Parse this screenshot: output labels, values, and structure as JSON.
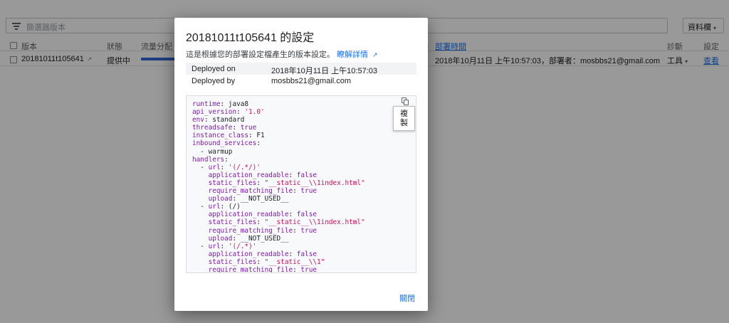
{
  "background": {
    "filter_placeholder": "篩選器版本",
    "columns_button": "資料欄",
    "columns_caret": "▾",
    "headers": {
      "version": "版本",
      "status": "狀態",
      "traffic": "流量分配",
      "deployed_time": "部署時間",
      "sort_arrow": "↓",
      "diagnose": "診斷",
      "config": "設定"
    },
    "row": {
      "version": "20181011t105641",
      "status": "提供中",
      "traffic_fraction": 1.0,
      "deployed": "2018年10月11日 上午10:57:03，部署者：mosbbs21@gmail.com",
      "tools": "工具",
      "tools_caret": "▾",
      "view": "查看"
    }
  },
  "dialog": {
    "title": "20181011t105641 的設定",
    "description": "這是根據您的部署設定檔產生的版本設定。",
    "learn_more": "瞭解詳情",
    "info": [
      {
        "key": "Deployed on",
        "value": "2018年10月11日 上午10:57:03"
      },
      {
        "key": "Deployed by",
        "value": "mosbbs21@gmail.com"
      }
    ],
    "copy_tooltip": [
      "複",
      "製"
    ],
    "close": "關閉",
    "code": [
      [
        [
          "key",
          "runtime"
        ],
        [
          "plain",
          ": java8"
        ]
      ],
      [
        [
          "key",
          "api_version"
        ],
        [
          "plain",
          ": "
        ],
        [
          "str",
          "'1.0'"
        ]
      ],
      [
        [
          "key",
          "env"
        ],
        [
          "plain",
          ": standard"
        ]
      ],
      [
        [
          "key",
          "threadsafe"
        ],
        [
          "plain",
          ": "
        ],
        [
          "bool",
          "true"
        ]
      ],
      [
        [
          "key",
          "instance_class"
        ],
        [
          "plain",
          ": F1"
        ]
      ],
      [
        [
          "key",
          "inbound_services"
        ],
        [
          "plain",
          ":"
        ]
      ],
      [
        [
          "plain",
          "  - warmup"
        ]
      ],
      [
        [
          "key",
          "handlers"
        ],
        [
          "plain",
          ":"
        ]
      ],
      [
        [
          "plain",
          "  - "
        ],
        [
          "key",
          "url"
        ],
        [
          "plain",
          ": "
        ],
        [
          "str",
          "'(/.*/)'"
        ]
      ],
      [
        [
          "plain",
          "    "
        ],
        [
          "key",
          "application_readable"
        ],
        [
          "plain",
          ": "
        ],
        [
          "bool",
          "false"
        ]
      ],
      [
        [
          "plain",
          "    "
        ],
        [
          "key",
          "static_files"
        ],
        [
          "plain",
          ": "
        ],
        [
          "str",
          "\"__static__\\\\1index.html\""
        ]
      ],
      [
        [
          "plain",
          "    "
        ],
        [
          "key",
          "require_matching_file"
        ],
        [
          "plain",
          ": "
        ],
        [
          "bool",
          "true"
        ]
      ],
      [
        [
          "plain",
          "    "
        ],
        [
          "key",
          "upload"
        ],
        [
          "plain",
          ": __NOT_USED__"
        ]
      ],
      [
        [
          "plain",
          "  - "
        ],
        [
          "key",
          "url"
        ],
        [
          "plain",
          ": (/)"
        ]
      ],
      [
        [
          "plain",
          "    "
        ],
        [
          "key",
          "application_readable"
        ],
        [
          "plain",
          ": "
        ],
        [
          "bool",
          "false"
        ]
      ],
      [
        [
          "plain",
          "    "
        ],
        [
          "key",
          "static_files"
        ],
        [
          "plain",
          ": "
        ],
        [
          "str",
          "\"__static__\\\\1index.html\""
        ]
      ],
      [
        [
          "plain",
          "    "
        ],
        [
          "key",
          "require_matching_file"
        ],
        [
          "plain",
          ": "
        ],
        [
          "bool",
          "true"
        ]
      ],
      [
        [
          "plain",
          "    "
        ],
        [
          "key",
          "upload"
        ],
        [
          "plain",
          ": __NOT_USED__"
        ]
      ],
      [
        [
          "plain",
          "  - "
        ],
        [
          "key",
          "url"
        ],
        [
          "plain",
          ": "
        ],
        [
          "str",
          "'(/.*)'"
        ]
      ],
      [
        [
          "plain",
          "    "
        ],
        [
          "key",
          "application_readable"
        ],
        [
          "plain",
          ": "
        ],
        [
          "bool",
          "false"
        ]
      ],
      [
        [
          "plain",
          "    "
        ],
        [
          "key",
          "static_files"
        ],
        [
          "plain",
          ": "
        ],
        [
          "str",
          "\"__static__\\\\1\""
        ]
      ],
      [
        [
          "plain",
          "    "
        ],
        [
          "key",
          "require_matching_file"
        ],
        [
          "plain",
          ": "
        ],
        [
          "bool",
          "true"
        ]
      ]
    ]
  },
  "colors": {
    "accent": "#1a73e8",
    "yaml_key": "#7b1fa2",
    "yaml_string": "#c2185b",
    "traffic_bar": "#3367d6",
    "scrim": "rgba(0,0,0,0.40)"
  },
  "icons": {
    "filter": "filter-icon",
    "external_link": "external-link-icon",
    "copy": "copy-icon",
    "dropdown": "chevron-down-icon"
  }
}
